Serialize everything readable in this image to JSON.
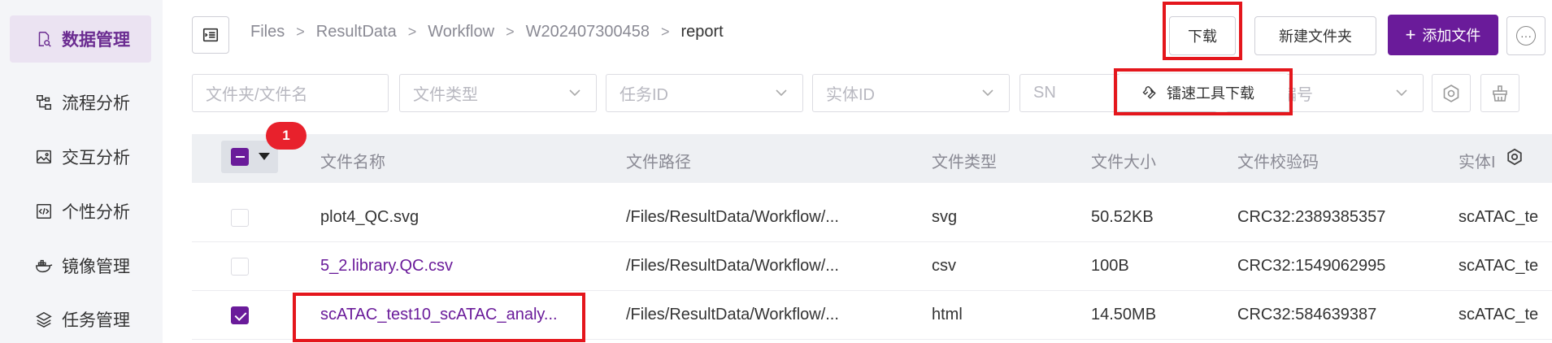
{
  "sidebar": {
    "items": [
      {
        "label": "数据管理",
        "icon": "file-search-icon",
        "active": true
      },
      {
        "label": "流程分析",
        "icon": "flow-icon",
        "active": false
      },
      {
        "label": "交互分析",
        "icon": "image-icon",
        "active": false
      },
      {
        "label": "个性分析",
        "icon": "code-file-icon",
        "active": false
      },
      {
        "label": "镜像管理",
        "icon": "docker-icon",
        "active": false
      },
      {
        "label": "任务管理",
        "icon": "layers-icon",
        "active": false
      }
    ]
  },
  "breadcrumb": [
    "Files",
    "ResultData",
    "Workflow",
    "W202407300458",
    "report"
  ],
  "toolbar": {
    "download_label": "下载",
    "new_folder_label": "新建文件夹",
    "add_file_label": "添加文件",
    "add_file_prefix": "+"
  },
  "download_menu": {
    "item_label": "镭速工具下载"
  },
  "filters": {
    "file_name_placeholder": "文件夹/文件名",
    "file_type_placeholder": "文件类型",
    "task_id_placeholder": "任务ID",
    "entity_id_placeholder": "实体ID",
    "sn_placeholder": "SN",
    "number_placeholder": "编号"
  },
  "table": {
    "selected_count_badge": "1",
    "headers": [
      "文件名称",
      "文件路径",
      "文件类型",
      "文件大小",
      "文件校验码",
      "实体I"
    ],
    "rows": [
      {
        "name": "plot4_QC.svg",
        "path": "/Files/ResultData/Workflow/...",
        "type": "svg",
        "size": "50.52KB",
        "checksum": "CRC32:2389385357",
        "entity": "scATAC_te",
        "checked": false,
        "is_link": false
      },
      {
        "name": "5_2.library.QC.csv",
        "path": "/Files/ResultData/Workflow/...",
        "type": "csv",
        "size": "100B",
        "checksum": "CRC32:1549062995",
        "entity": "scATAC_te",
        "checked": false,
        "is_link": true
      },
      {
        "name": "scATAC_test10_scATAC_analy...",
        "path": "/Files/ResultData/Workflow/...",
        "type": "html",
        "size": "14.50MB",
        "checksum": "CRC32:584639387",
        "entity": "scATAC_te",
        "checked": true,
        "is_link": true
      }
    ]
  },
  "colors": {
    "accent": "#6a1b9a",
    "highlight_box": "#e4161c",
    "sidebar_bg": "#f4f5f8"
  }
}
